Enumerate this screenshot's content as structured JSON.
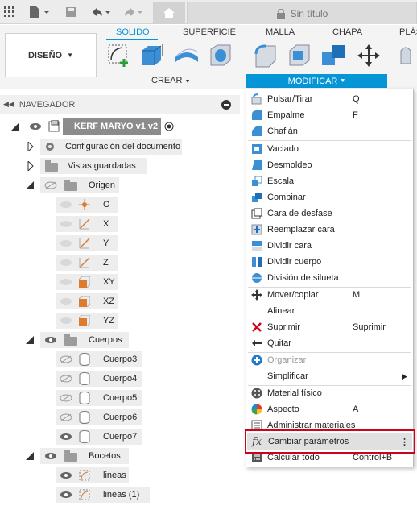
{
  "titlebar": {
    "doc_title": "Sin título"
  },
  "ribbon": {
    "design_label": "DISEÑO",
    "tabs": [
      "SOLIDO",
      "SUPERFICIE",
      "MALLA",
      "CHAPA",
      "PLÁS"
    ],
    "create_label": "CREAR",
    "modify_label": "MODIFICAR"
  },
  "navigator": {
    "title": "NAVEGADOR",
    "root": "KERF MARYO v1 v2",
    "items": {
      "doc_settings": "Configuración del documento",
      "saved_views": "Vistas guardadas",
      "origin": "Origen",
      "o": "O",
      "x": "X",
      "y": "Y",
      "z": "Z",
      "xy": "XY",
      "xz": "XZ",
      "yz": "YZ",
      "bodies": "Cuerpos",
      "b3": "Cuerpo3",
      "b4": "Cuerpo4",
      "b5": "Cuerpo5",
      "b6": "Cuerpo6",
      "b7": "Cuerpo7",
      "sketches": "Bocetos",
      "s1": "lineas",
      "s2": "lineas (1)"
    }
  },
  "menu": {
    "items": [
      {
        "label": "Pulsar/Tirar",
        "key": "Q"
      },
      {
        "label": "Empalme",
        "key": "F"
      },
      {
        "label": "Chaflán",
        "key": ""
      },
      {
        "label": "Vaciado",
        "key": ""
      },
      {
        "label": "Desmoldeo",
        "key": ""
      },
      {
        "label": "Escala",
        "key": ""
      },
      {
        "label": "Combinar",
        "key": ""
      },
      {
        "label": "Cara de desfase",
        "key": ""
      },
      {
        "label": "Reemplazar cara",
        "key": ""
      },
      {
        "label": "Dividir cara",
        "key": ""
      },
      {
        "label": "Dividir cuerpo",
        "key": ""
      },
      {
        "label": "División de silueta",
        "key": ""
      },
      {
        "label": "Mover/copiar",
        "key": "M"
      },
      {
        "label": "Alinear",
        "key": ""
      },
      {
        "label": "Suprimir",
        "key": "Suprimir"
      },
      {
        "label": "Quitar",
        "key": ""
      },
      {
        "label": "Organizar",
        "key": ""
      },
      {
        "label": "Simplificar",
        "key": ""
      },
      {
        "label": "Material físico",
        "key": ""
      },
      {
        "label": "Aspecto",
        "key": "A"
      },
      {
        "label": "Administrar materiales",
        "key": ""
      },
      {
        "label": "Cambiar parámetros",
        "key": ""
      },
      {
        "label": "Calcular todo",
        "key": "Control+B"
      }
    ]
  }
}
